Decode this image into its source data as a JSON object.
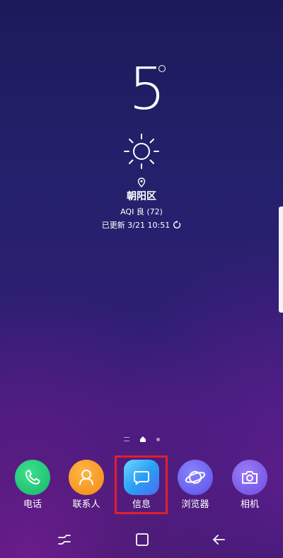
{
  "weather": {
    "temperature": "5",
    "location": "朝阳区",
    "aqi": "AQI 良 (72)",
    "updated": "已更新 3/21 10:51",
    "condition_icon": "sun-icon"
  },
  "dock": {
    "apps": [
      {
        "label": "电话",
        "icon": "phone-icon",
        "color": "#1fc276"
      },
      {
        "label": "联系人",
        "icon": "contact-person-icon",
        "color": "#f6991e"
      },
      {
        "label": "信息",
        "icon": "message-bubble-icon",
        "color": "#2aa0f5"
      },
      {
        "label": "浏览器",
        "icon": "planet-icon",
        "color": "#6b60f0"
      },
      {
        "label": "相机",
        "icon": "camera-icon",
        "color": "#7a5ae8"
      }
    ]
  },
  "highlight_color": "#e0202a",
  "page_indicators": {
    "current": "home"
  }
}
